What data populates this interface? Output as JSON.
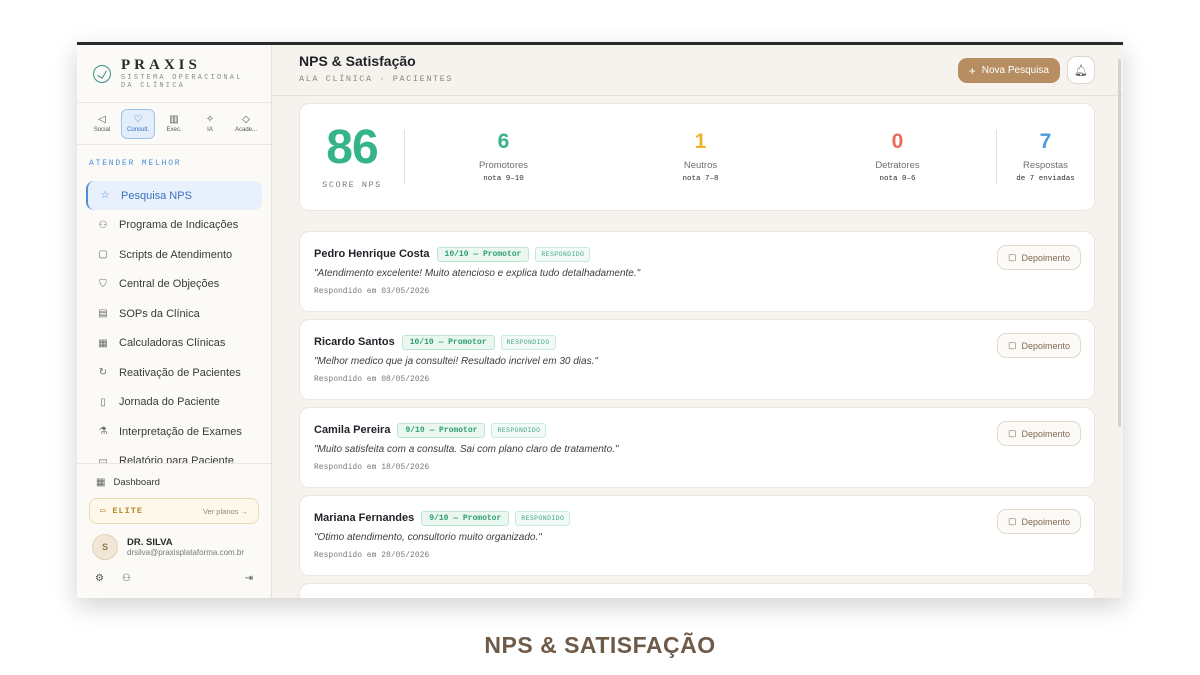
{
  "brand": {
    "name": "PRAXIS",
    "subtitle": "SISTEMA OPERACIONAL DA CLÍNICA"
  },
  "modules": [
    {
      "label": "Social",
      "icon": "megaphone-icon",
      "glyph": "◁",
      "active": false
    },
    {
      "label": "Consult.",
      "icon": "stethoscope-icon",
      "glyph": "♡",
      "active": true
    },
    {
      "label": "Exec.",
      "icon": "bar-chart-icon",
      "glyph": "▥",
      "active": false
    },
    {
      "label": "IA",
      "icon": "sparkles-icon",
      "glyph": "✧",
      "active": false
    },
    {
      "label": "Acade...",
      "icon": "graduation-cap-icon",
      "glyph": "◇",
      "active": false
    }
  ],
  "sidebar": {
    "section": "ATENDER MELHOR",
    "items": [
      {
        "label": "Pesquisa NPS",
        "icon": "star-icon",
        "glyph": "☆",
        "active": true
      },
      {
        "label": "Programa de Indicações",
        "icon": "user-plus-icon",
        "glyph": "⚇",
        "active": false
      },
      {
        "label": "Scripts de Atendimento",
        "icon": "message-square-icon",
        "glyph": "▢",
        "active": false
      },
      {
        "label": "Central de Objeções",
        "icon": "shield-icon",
        "glyph": "⛉",
        "active": false
      },
      {
        "label": "SOPs da Clínica",
        "icon": "clipboard-icon",
        "glyph": "▤",
        "active": false
      },
      {
        "label": "Calculadoras Clínicas",
        "icon": "calculator-icon",
        "glyph": "▦",
        "active": false
      },
      {
        "label": "Reativação de Pacientes",
        "icon": "refresh-icon",
        "glyph": "↻",
        "active": false
      },
      {
        "label": "Jornada do Paciente",
        "icon": "map-icon",
        "glyph": "▯",
        "active": false
      },
      {
        "label": "Interpretação de Exames",
        "icon": "flask-icon",
        "glyph": "⚗",
        "active": false
      },
      {
        "label": "Relatório para Paciente",
        "icon": "file-icon",
        "glyph": "▭",
        "active": false
      }
    ],
    "dashboard": "Dashboard",
    "plan": {
      "name": "ELITE",
      "link": "Ver planos →"
    },
    "user": {
      "initial": "S",
      "name": "DR. SILVA",
      "email": "drsilva@praxisplataforma.com.br"
    }
  },
  "header": {
    "title": "NPS & Satisfação",
    "breadcrumb": "ALA CLÍNICA · PACIENTES",
    "new_button": "Nova Pesquisa"
  },
  "stats": {
    "score": "86",
    "score_label": "SCORE NPS",
    "items": [
      {
        "value": "6",
        "label": "Promotores",
        "sub": "nota 9–10",
        "color": "#34b488"
      },
      {
        "value": "1",
        "label": "Neutros",
        "sub": "nota 7–8",
        "color": "#f0b429"
      },
      {
        "value": "0",
        "label": "Detratores",
        "sub": "nota 0–6",
        "color": "#ea6a5e"
      },
      {
        "value": "7",
        "label": "Respostas",
        "sub": "de 7 enviadas",
        "color": "#4c9be0"
      }
    ]
  },
  "responses": [
    {
      "name": "Pedro Henrique Costa",
      "score": "10/10 — Promotor",
      "status": "RESPONDIDO",
      "quote": "\"Atendimento excelente! Muito atencioso e explica tudo detalhadamente.\"",
      "date": "Respondido em 03/05/2026",
      "action": "Depoimento"
    },
    {
      "name": "Ricardo Santos",
      "score": "10/10 — Promotor",
      "status": "RESPONDIDO",
      "quote": "\"Melhor medico que ja consultei! Resultado incrivel em 30 dias.\"",
      "date": "Respondido em 08/05/2026",
      "action": "Depoimento"
    },
    {
      "name": "Camila Pereira",
      "score": "9/10 — Promotor",
      "status": "RESPONDIDO",
      "quote": "\"Muito satisfeita com a consulta. Sai com plano claro de tratamento.\"",
      "date": "Respondido em 18/05/2026",
      "action": "Depoimento"
    },
    {
      "name": "Mariana Fernandes",
      "score": "9/10 — Promotor",
      "status": "RESPONDIDO",
      "quote": "\"Otimo atendimento, consultorio muito organizado.\"",
      "date": "Respondido em 28/05/2026",
      "action": "Depoimento"
    }
  ],
  "caption": "NPS & SATISFAÇÃO"
}
